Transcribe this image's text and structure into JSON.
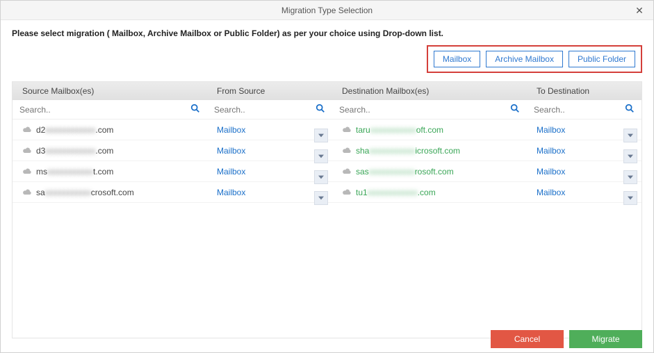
{
  "window": {
    "title": "Migration Type Selection"
  },
  "instruction": "Please select migration ( Mailbox, Archive Mailbox or Public Folder) as per your choice using Drop-down list.",
  "typeButtons": {
    "mailbox": "Mailbox",
    "archive": "Archive Mailbox",
    "public": "Public Folder"
  },
  "columns": {
    "src": "Source Mailbox(es)",
    "from": "From Source",
    "dst": "Destination Mailbox(es)",
    "to": "To Destination"
  },
  "search": {
    "placeholder": "Search.."
  },
  "dropdown": {
    "label": "Mailbox"
  },
  "rows": [
    {
      "srcPre": "d2",
      "srcBlur": "xxxxxxxxxxxx",
      "srcPost": ".com",
      "dstPre": "taru",
      "dstBlur": "xxxxxxxxxxx",
      "dstPost": "oft.com"
    },
    {
      "srcPre": "d3",
      "srcBlur": "xxxxxxxxxxxx",
      "srcPost": ".com",
      "dstPre": "sha",
      "dstBlur": "xxxxxxxxxxx",
      "dstPost": "icrosoft.com"
    },
    {
      "srcPre": "ms",
      "srcBlur": "xxxxxxxxxxx",
      "srcPost": "t.com",
      "dstPre": "sas",
      "dstBlur": "xxxxxxxxxxx",
      "dstPost": "rosoft.com"
    },
    {
      "srcPre": "sa",
      "srcBlur": "xxxxxxxxxxx",
      "srcPost": "crosoft.com",
      "dstPre": "tu1",
      "dstBlur": "xxxxxxxxxxxx",
      "dstPost": ".com"
    }
  ],
  "footer": {
    "cancel": "Cancel",
    "migrate": "Migrate"
  }
}
